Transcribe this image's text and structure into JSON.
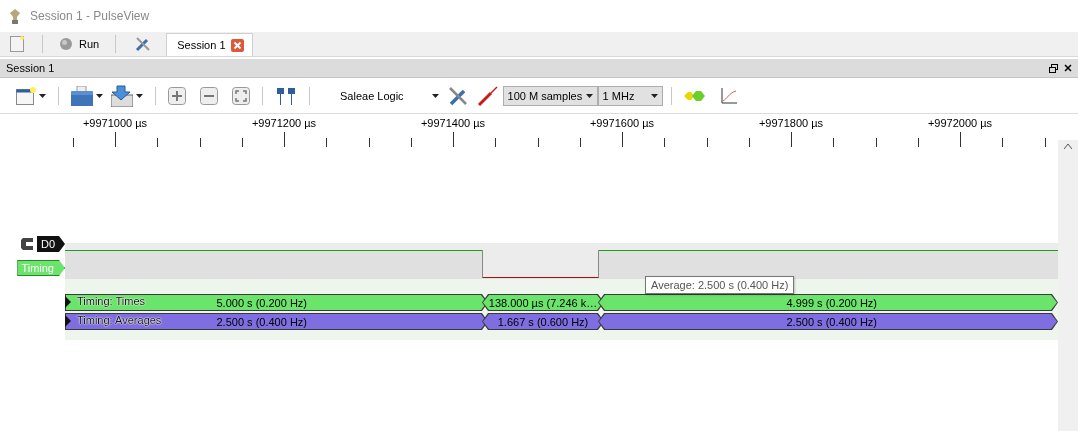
{
  "window": {
    "title": "Session 1 - PulseView"
  },
  "main_toolbar": {
    "run_button": "Run"
  },
  "tabs": [
    {
      "label": "Session 1",
      "selected": true
    }
  ],
  "session_panel": {
    "title": "Session 1"
  },
  "toolbar": {
    "device": "Saleae Logic",
    "samples": "100 M samples",
    "rate": "1 MHz"
  },
  "ruler": {
    "labels": [
      "+9971000 µs",
      "+9971200 µs",
      "+9971400 µs",
      "+9971600 µs",
      "+9971800 µs",
      "+9972000 µs"
    ]
  },
  "channels": [
    {
      "name": "D0"
    }
  ],
  "decoder": {
    "name": "Timing",
    "color": "#6be46b",
    "rows": [
      {
        "name": "Timing: Times",
        "color": "#6be46b",
        "segments": [
          "5.000 s  (0.200 Hz)",
          "138.000 µs (7.246 k…",
          "4.999 s  (0.200 Hz)"
        ]
      },
      {
        "name": "Timing: Averages",
        "color": "#7e6ee2",
        "segments": [
          "2.500 s  (0.400 Hz)",
          "1.667 s  (0.600 Hz)",
          "2.500 s  (0.400 Hz)"
        ]
      }
    ]
  },
  "tooltip": "Average: 2.500 s  (0.400 Hz)"
}
